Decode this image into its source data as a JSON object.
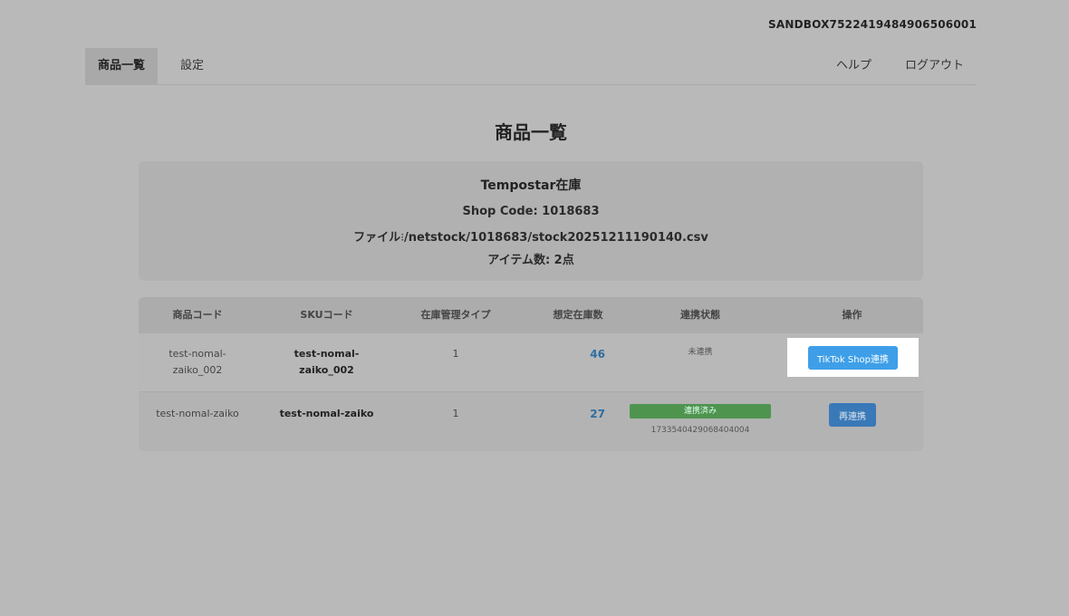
{
  "header": {
    "sandbox_id": "SANDBOX7522419484906506001"
  },
  "nav": {
    "tabs": [
      {
        "label": "商品一覧",
        "active": true
      },
      {
        "label": "設定",
        "active": false
      }
    ],
    "help_label": "ヘルプ",
    "logout_label": "ログアウト"
  },
  "page": {
    "title": "商品一覧"
  },
  "info": {
    "title": "Tempostar在庫",
    "shop_code": "Shop Code: 1018683",
    "file_label": "ファイル",
    "file_path": "/netstock/1018683/stock20251211190140.csv",
    "item_count": "アイテム数: 2点"
  },
  "table": {
    "headers": [
      "商品コード",
      "SKUコード",
      "在庫管理タイプ",
      "想定在庫数",
      "連携状態",
      "操作"
    ],
    "rows": [
      {
        "product_code_line1": "test-nomal-",
        "product_code_line2": "zaiko_002",
        "sku_line1": "test-nomal-",
        "sku_line2": "zaiko_002",
        "stock_type": "1",
        "stock_qty": "46",
        "status": "未連携",
        "action": "TikTok Shop連携"
      },
      {
        "product_code": "test-nomal-zaiko",
        "sku": "test-nomal-zaiko",
        "stock_type": "1",
        "stock_qty": "27",
        "status": "連携済み",
        "linked_id": "1733540429068404004",
        "action": "再連携"
      }
    ]
  },
  "colors": {
    "accent": "#3e9fe8",
    "linked_badge": "#4e944f",
    "relink_button": "#3a79b7",
    "overlay": "#b9b9b9"
  }
}
